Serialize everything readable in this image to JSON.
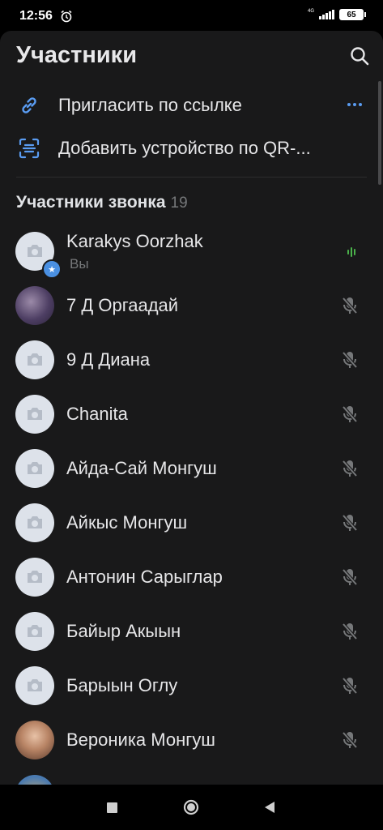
{
  "status_bar": {
    "time": "12:56",
    "network": "4G",
    "battery": "65"
  },
  "header": {
    "title": "Участники"
  },
  "actions": {
    "invite_link": "Пригласить по ссылке",
    "add_device": "Добавить устройство по QR-..."
  },
  "section": {
    "title": "Участники звонка",
    "count": "19"
  },
  "participants": [
    {
      "name": "Karakys Oorzhak",
      "sub": "Вы",
      "status": "speaking"
    },
    {
      "name": "7 Д Оргаадай",
      "status": "muted"
    },
    {
      "name": "9 Д Диана",
      "status": "muted"
    },
    {
      "name": "Chanita",
      "status": "muted"
    },
    {
      "name": "Айда-Сай Монгуш",
      "status": "muted"
    },
    {
      "name": "Айкыс Монгуш",
      "status": "muted"
    },
    {
      "name": "Антонин Сарыглар",
      "status": "muted"
    },
    {
      "name": "Байыр Акыын",
      "status": "muted"
    },
    {
      "name": "Барыын Оглу",
      "status": "muted"
    },
    {
      "name": "Вероника Монгуш",
      "status": "muted"
    }
  ],
  "colors": {
    "accent": "#5a9cf2",
    "panel": "#19191a",
    "speaking": "#4bb34b",
    "muted_icon": "#76787a"
  },
  "icons": {
    "search": "search-icon",
    "link": "link-icon",
    "qr": "qr-scan-icon",
    "camera": "camera-icon",
    "mic_off": "mic-off-icon"
  }
}
